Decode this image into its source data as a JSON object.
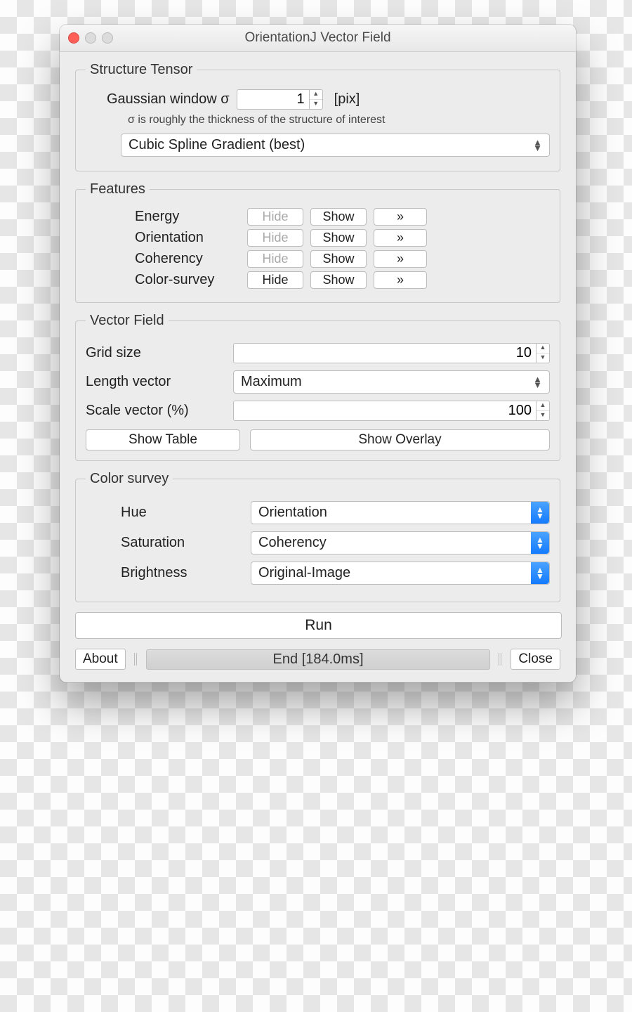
{
  "window": {
    "title": "OrientationJ Vector Field"
  },
  "structure_tensor": {
    "legend": "Structure Tensor",
    "gaussian_label": "Gaussian window σ",
    "gaussian_value": "1",
    "gaussian_unit": "[pix]",
    "hint": "σ is roughly the thickness of the structure of interest",
    "gradient_select": "Cubic Spline Gradient (best)"
  },
  "features": {
    "legend": "Features",
    "rows": [
      {
        "label": "Energy",
        "hide": "Hide",
        "show": "Show",
        "more": "»",
        "hide_enabled": false
      },
      {
        "label": "Orientation",
        "hide": "Hide",
        "show": "Show",
        "more": "»",
        "hide_enabled": false
      },
      {
        "label": "Coherency",
        "hide": "Hide",
        "show": "Show",
        "more": "»",
        "hide_enabled": false
      },
      {
        "label": "Color-survey",
        "hide": "Hide",
        "show": "Show",
        "more": "»",
        "hide_enabled": true
      }
    ]
  },
  "vector_field": {
    "legend": "Vector Field",
    "grid_label": "Grid size",
    "grid_value": "10",
    "length_label": "Length vector",
    "length_select": "Maximum",
    "scale_label": "Scale vector (%)",
    "scale_value": "100",
    "show_table": "Show Table",
    "show_overlay": "Show Overlay"
  },
  "color_survey": {
    "legend": "Color survey",
    "hue_label": "Hue",
    "hue_select": "Orientation",
    "sat_label": "Saturation",
    "sat_select": "Coherency",
    "bri_label": "Brightness",
    "bri_select": "Original-Image"
  },
  "actions": {
    "run": "Run",
    "about": "About",
    "status": "End [184.0ms]",
    "close": "Close"
  }
}
